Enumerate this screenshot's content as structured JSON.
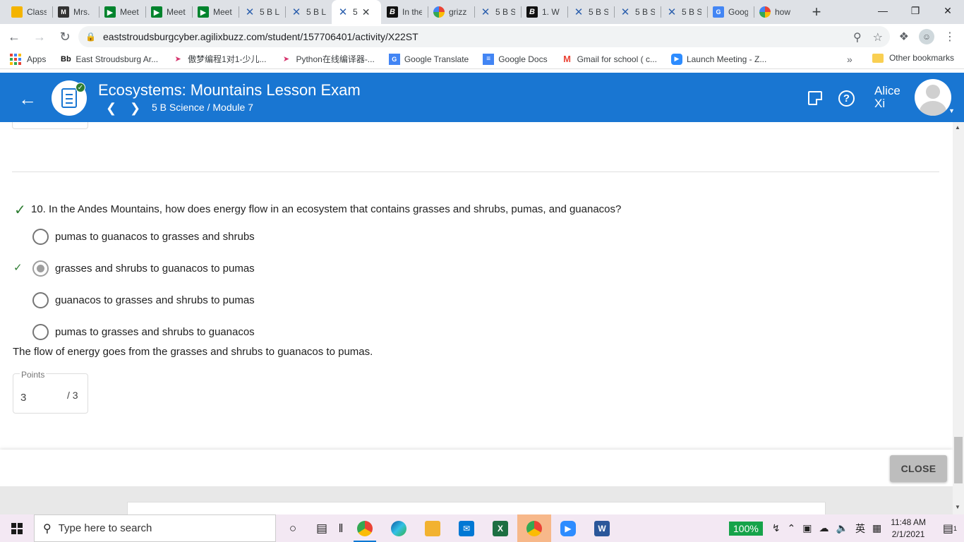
{
  "browser": {
    "tabs": [
      {
        "title": "Class",
        "icon": "google-classroom-icon"
      },
      {
        "title": "Mrs.",
        "icon": "mrs-icon"
      },
      {
        "title": "Meet",
        "icon": "google-meet-icon"
      },
      {
        "title": "Meet",
        "icon": "google-meet-icon"
      },
      {
        "title": "Meet",
        "icon": "google-meet-icon"
      },
      {
        "title": "5 B L",
        "icon": "buzz-x-icon"
      },
      {
        "title": "5 B L",
        "icon": "buzz-x-icon"
      },
      {
        "title": "5",
        "icon": "buzz-x-icon",
        "active": true
      },
      {
        "title": "In the",
        "icon": "bing-icon"
      },
      {
        "title": "grizz",
        "icon": "google-icon"
      },
      {
        "title": "5 B S",
        "icon": "buzz-x-icon"
      },
      {
        "title": "1. W",
        "icon": "bing-icon"
      },
      {
        "title": "5 B S",
        "icon": "buzz-x-icon"
      },
      {
        "title": "5 B S",
        "icon": "buzz-x-icon"
      },
      {
        "title": "5 B S",
        "icon": "buzz-x-icon"
      },
      {
        "title": "Goog",
        "icon": "google-translate-icon"
      },
      {
        "title": "how",
        "icon": "google-icon"
      }
    ],
    "url": "eaststroudsburgcyber.agilixbuzz.com/student/157706401/activity/X22ST",
    "bookmarks": [
      {
        "label": "Apps"
      },
      {
        "label": "East Stroudsburg Ar..."
      },
      {
        "label": "傲梦编程1对1-少儿..."
      },
      {
        "label": "Python在线编译器-..."
      },
      {
        "label": "Google Translate"
      },
      {
        "label": "Google Docs"
      },
      {
        "label": "Gmail for school ( c..."
      },
      {
        "label": "Launch Meeting - Z..."
      }
    ],
    "more_bookmarks": "»",
    "other_bookmarks": "Other bookmarks"
  },
  "header": {
    "title": "Ecosystems: Mountains Lesson Exam",
    "breadcrumb": "5 B Science / Module 7",
    "user_name": "Alice Xi"
  },
  "question": {
    "number": "10.",
    "text": "In the Andes Mountains, how does energy flow in an ecosystem that contains grasses and shrubs, pumas, and guanacos?",
    "options": [
      {
        "label": "pumas to guanacos to grasses and shrubs",
        "selected": false
      },
      {
        "label": "grasses and shrubs to guanacos to pumas",
        "selected": true
      },
      {
        "label": "guanacos to grasses and shrubs to pumas",
        "selected": false
      },
      {
        "label": "pumas to grasses and shrubs to guanacos",
        "selected": false
      }
    ],
    "feedback": "The flow of energy goes from the grasses and shrubs to guanacos to pumas.",
    "points_label": "Points",
    "points_earned": "3",
    "points_max": "/ 3"
  },
  "footer": {
    "close_label": "CLOSE"
  },
  "taskbar": {
    "search_placeholder": "Type here to search",
    "battery": "100%",
    "ime": "英",
    "time": "11:48 AM",
    "date": "2/1/2021",
    "notification_count": "1"
  },
  "colors": {
    "header_blue": "#1976d2",
    "correct_green": "#2e7d32",
    "close_button_gray": "#bdbdbd"
  }
}
